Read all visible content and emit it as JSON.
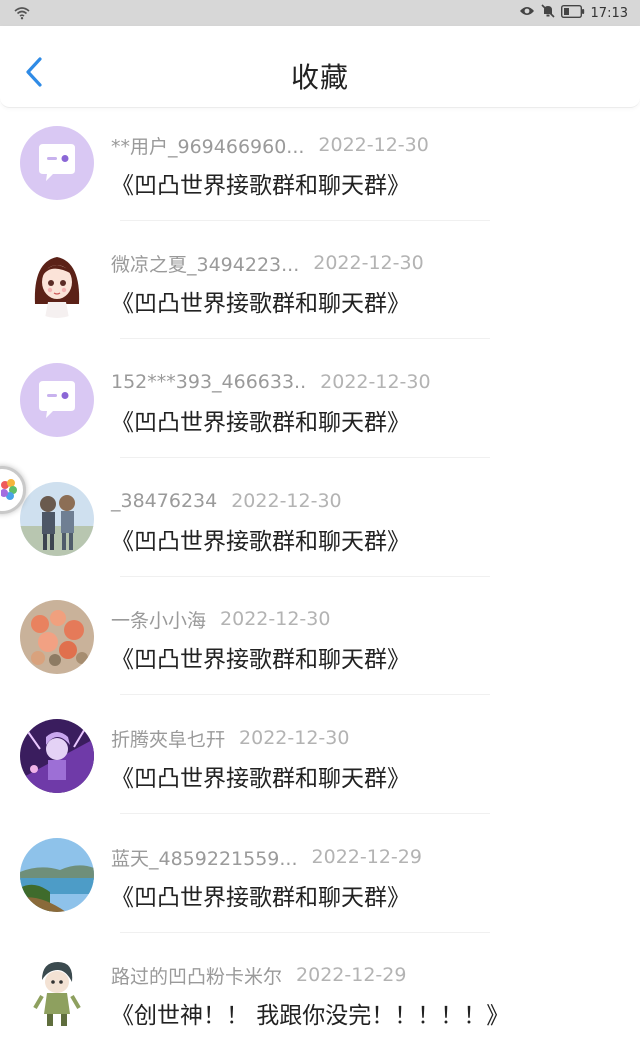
{
  "status_bar": {
    "time": "17:13"
  },
  "header": {
    "title": "收藏"
  },
  "items": [
    {
      "user": "**用户_969466960...",
      "date": "2022-12-30",
      "title": "《凹凸世界接歌群和聊天群》",
      "avatar": "default-chat-avatar"
    },
    {
      "user": "微凉之夏_3494223...",
      "date": "2022-12-30",
      "title": "《凹凸世界接歌群和聊天群》",
      "avatar": "anime-girl-avatar"
    },
    {
      "user": "152***393_466633..",
      "date": "2022-12-30",
      "title": "《凹凸世界接歌群和聊天群》",
      "avatar": "default-chat-avatar"
    },
    {
      "user": "_38476234",
      "date": "2022-12-30",
      "title": "《凹凸世界接歌群和聊天群》",
      "avatar": "anime-boys-avatar"
    },
    {
      "user": "一条小小海",
      "date": "2022-12-30",
      "title": "《凹凸世界接歌群和聊天群》",
      "avatar": "flowers-avatar"
    },
    {
      "user": "折腾夾阜乜幵",
      "date": "2022-12-30",
      "title": "《凹凸世界接歌群和聊天群》",
      "avatar": "purple-anime-avatar"
    },
    {
      "user": "蓝天_4859221559...",
      "date": "2022-12-29",
      "title": "《凹凸世界接歌群和聊天群》",
      "avatar": "landscape-avatar"
    },
    {
      "user": "路过的凹凸粉卡米尔",
      "date": "2022-12-29",
      "title": "《创世神！！ 我跟你没完！！！！！》",
      "avatar": "chibi-character-avatar"
    }
  ],
  "colors": {
    "accent": "#2f8be6",
    "default_avatar_bg": "#d9c8f3",
    "status_bar_bg": "#d7d7d7"
  }
}
